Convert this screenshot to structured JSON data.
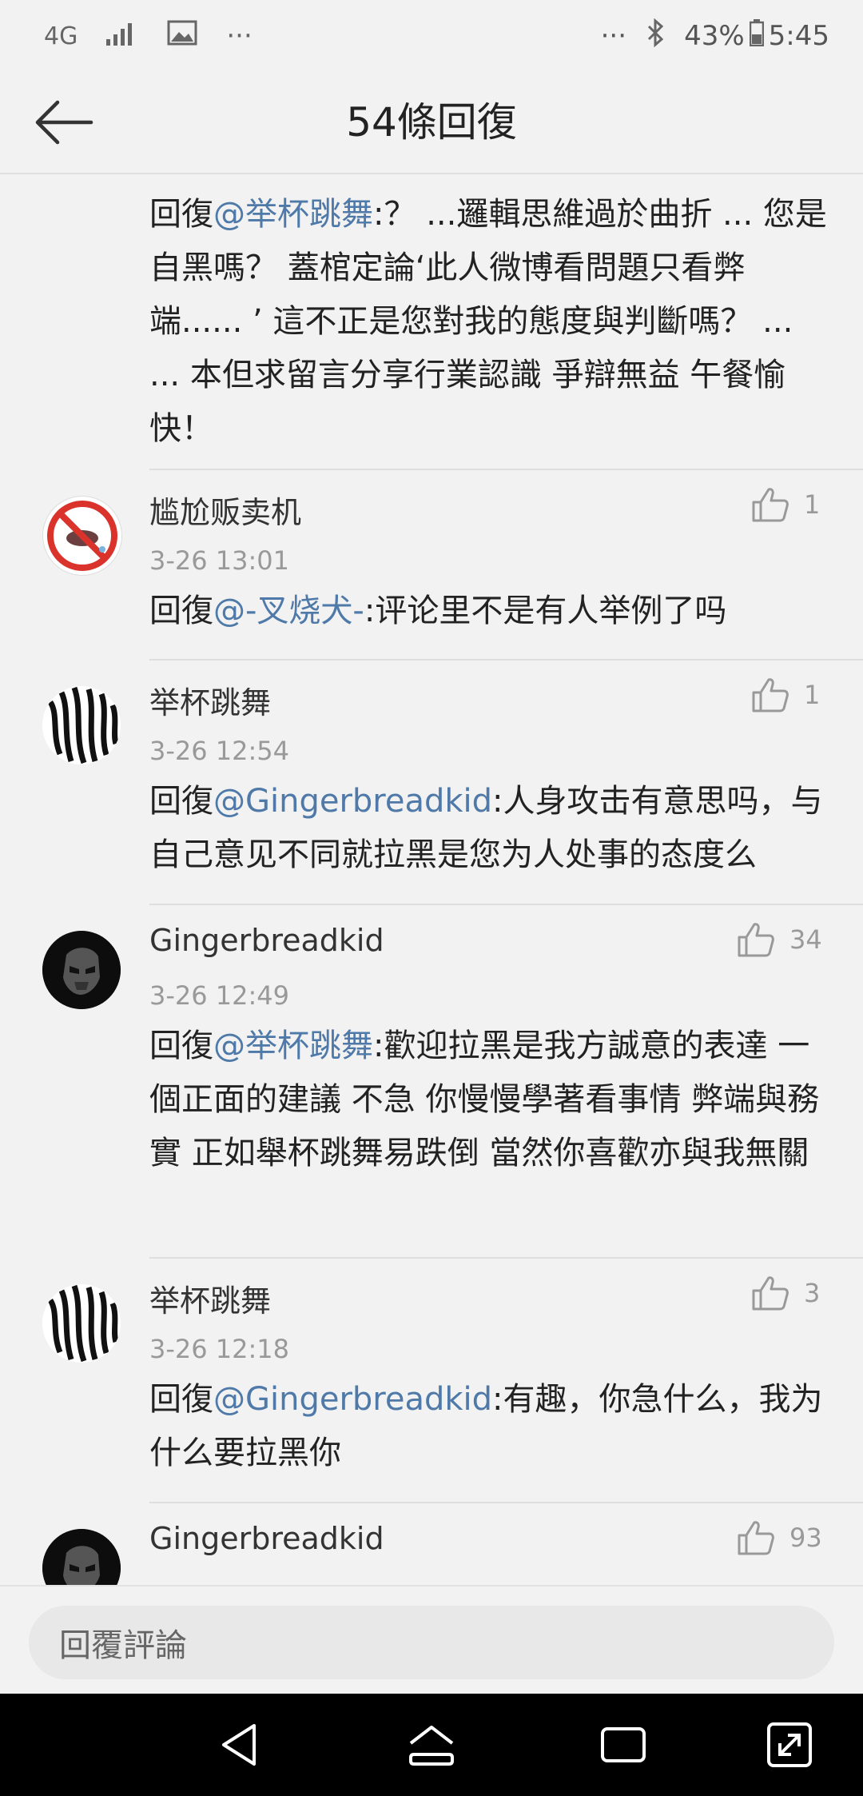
{
  "status_bar": {
    "network": "4G",
    "battery": "43%",
    "time": "5:45",
    "more_left": "···",
    "more_right": "···"
  },
  "header": {
    "title": "54條回復"
  },
  "comments": [
    {
      "text_prefix": "回復",
      "mention": "@举杯跳舞",
      "text": ":？ ...邏輯思維過於曲折 ... 您是自黑嗎？ 蓋棺定論‘此人微博看問題只看弊端...... ’ 這不正是您對我的態度與判斷嗎？ ... ... 本但求留言分享行業認識 爭辯無益 午餐愉快！"
    },
    {
      "name": "尴尬贩卖机",
      "time": "3-26 13:01",
      "likes": "1",
      "text_prefix": "回復",
      "mention": "@-叉烧犬-",
      "text": ":评论里不是有人举例了吗"
    },
    {
      "name": "举杯跳舞",
      "time": "3-26 12:54",
      "likes": "1",
      "text_prefix": "回復",
      "mention": "@Gingerbreadkid",
      "text": ":人身攻击有意思吗，与自己意见不同就拉黑是您为人处事的态度么"
    },
    {
      "name": "Gingerbreadkid",
      "time": "3-26 12:49",
      "likes": "34",
      "text_prefix": "回復",
      "mention": "@举杯跳舞",
      "text": ":歡迎拉黑是我方誠意的表達 一個正面的建議 不急 你慢慢學著看事情 弊端與務實 正如舉杯跳舞易跌倒 當然你喜歡亦與我無關"
    },
    {
      "name": "举杯跳舞",
      "time": "3-26 12:18",
      "likes": "3",
      "text_prefix": "回復",
      "mention": "@Gingerbreadkid",
      "text": ":有趣，你急什么，我为什么要拉黑你"
    },
    {
      "name": "Gingerbreadkid",
      "likes": "93"
    }
  ],
  "reply": {
    "placeholder": "回覆評論"
  }
}
